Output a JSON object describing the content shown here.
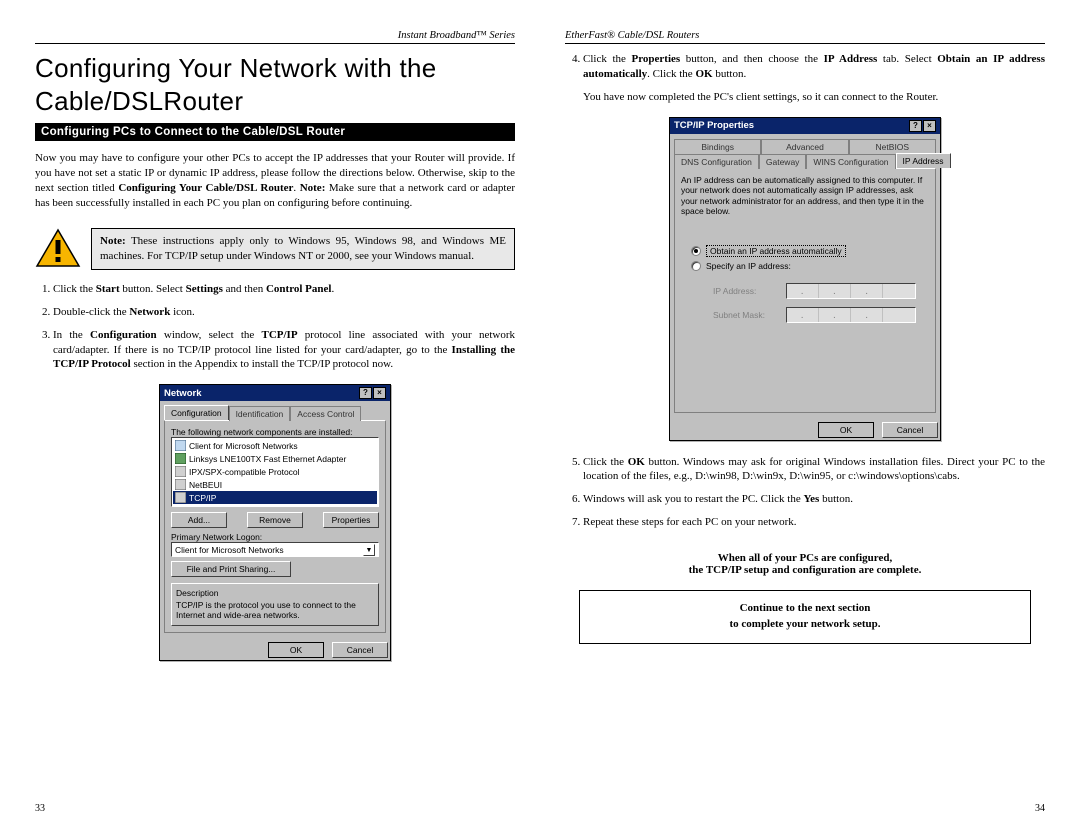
{
  "left": {
    "header": "Instant Broadband™ Series",
    "title": "Configuring Your Network with the Cable/DSLRouter",
    "section_bar": "Configuring PCs to Connect to the Cable/DSL Router",
    "intro_html": "Now you may have to configure your other PCs to accept the IP addresses that your Router will provide.  If you have not set a static IP or dynamic IP address, please follow the directions below.  Otherwise, skip to the next section titled <b>Configuring Your Cable/DSL Router</b>. <b>Note:</b> Make sure that a network card or adapter has been successfully installed in each PC you plan on configuring before continuing.",
    "note_html": "<b>Note:</b> These instructions apply only to Windows 95, Windows 98, and Windows ME machines.  For TCP/IP setup under Windows NT or 2000, see your Windows manual.",
    "steps": [
      "Click the <b>Start</b> button. Select <b>Settings</b> and then <b>Control Panel</b>.",
      "Double-click the <b>Network</b> icon.",
      "In the <b>Configuration</b> window, select the <b>TCP/IP</b> protocol line associated with your network card/adapter. If there is no TCP/IP protocol line listed for your card/adapter, go to the <b>Installing the TCP/IP Protocol</b> section in the Appendix to install the TCP/IP protocol now."
    ],
    "dialog": {
      "title": "Network",
      "tabs": [
        "Configuration",
        "Identification",
        "Access Control"
      ],
      "list_label": "The following network components are installed:",
      "items": [
        "Client for Microsoft Networks",
        "Linksys LNE100TX Fast Ethernet Adapter",
        "IPX/SPX-compatible Protocol",
        "NetBEUI",
        "TCP/IP"
      ],
      "buttons": {
        "add": "Add...",
        "remove": "Remove",
        "properties": "Properties"
      },
      "logon_label": "Primary Network Logon:",
      "logon_value": "Client for Microsoft Networks",
      "fps_button": "File and Print Sharing...",
      "desc_label": "Description",
      "desc_text": "TCP/IP is the protocol you use to connect to the Internet and wide-area networks.",
      "ok": "OK",
      "cancel": "Cancel"
    },
    "page": "33"
  },
  "right": {
    "header": "EtherFast® Cable/DSL Routers",
    "step4_html": "Click the <b>Properties</b> button, and then choose the <b>IP Address</b> tab. Select <b>Obtain an IP address automatically</b>. Click the <b>OK</b> button.",
    "after4": "You have now completed the PC's client settings, so it can connect to the Router.",
    "dialog": {
      "title": "TCP/IP Properties",
      "tabs_row1": [
        "Bindings",
        "Advanced",
        "NetBIOS"
      ],
      "tabs_row2": [
        "DNS Configuration",
        "Gateway",
        "WINS Configuration",
        "IP Address"
      ],
      "blurb": "An IP address can be automatically assigned to this computer. If your network does not automatically assign IP addresses, ask your network administrator for an address, and then type it in the space below.",
      "opt_auto": "Obtain an IP address automatically",
      "opt_spec": "Specify an IP address:",
      "ip_label": "IP Address:",
      "mask_label": "Subnet Mask:",
      "ok": "OK",
      "cancel": "Cancel"
    },
    "step5_html": "Click the <b>OK</b> button. Windows may ask for original Windows installation files. Direct your PC to the location of the files, e.g., D:\\win98, D:\\win9x, D:\\win95, or c:\\windows\\options\\cabs.",
    "step6_html": "Windows will ask you to restart the PC. Click the <b>Yes</b> button.",
    "step7": "Repeat these steps for each PC on your network.",
    "done_l1": "When all of your PCs are configured,",
    "done_l2": "the TCP/IP setup and configuration are complete.",
    "cont_l1": "Continue to the next section",
    "cont_l2": "to complete your network setup.",
    "page": "34"
  }
}
